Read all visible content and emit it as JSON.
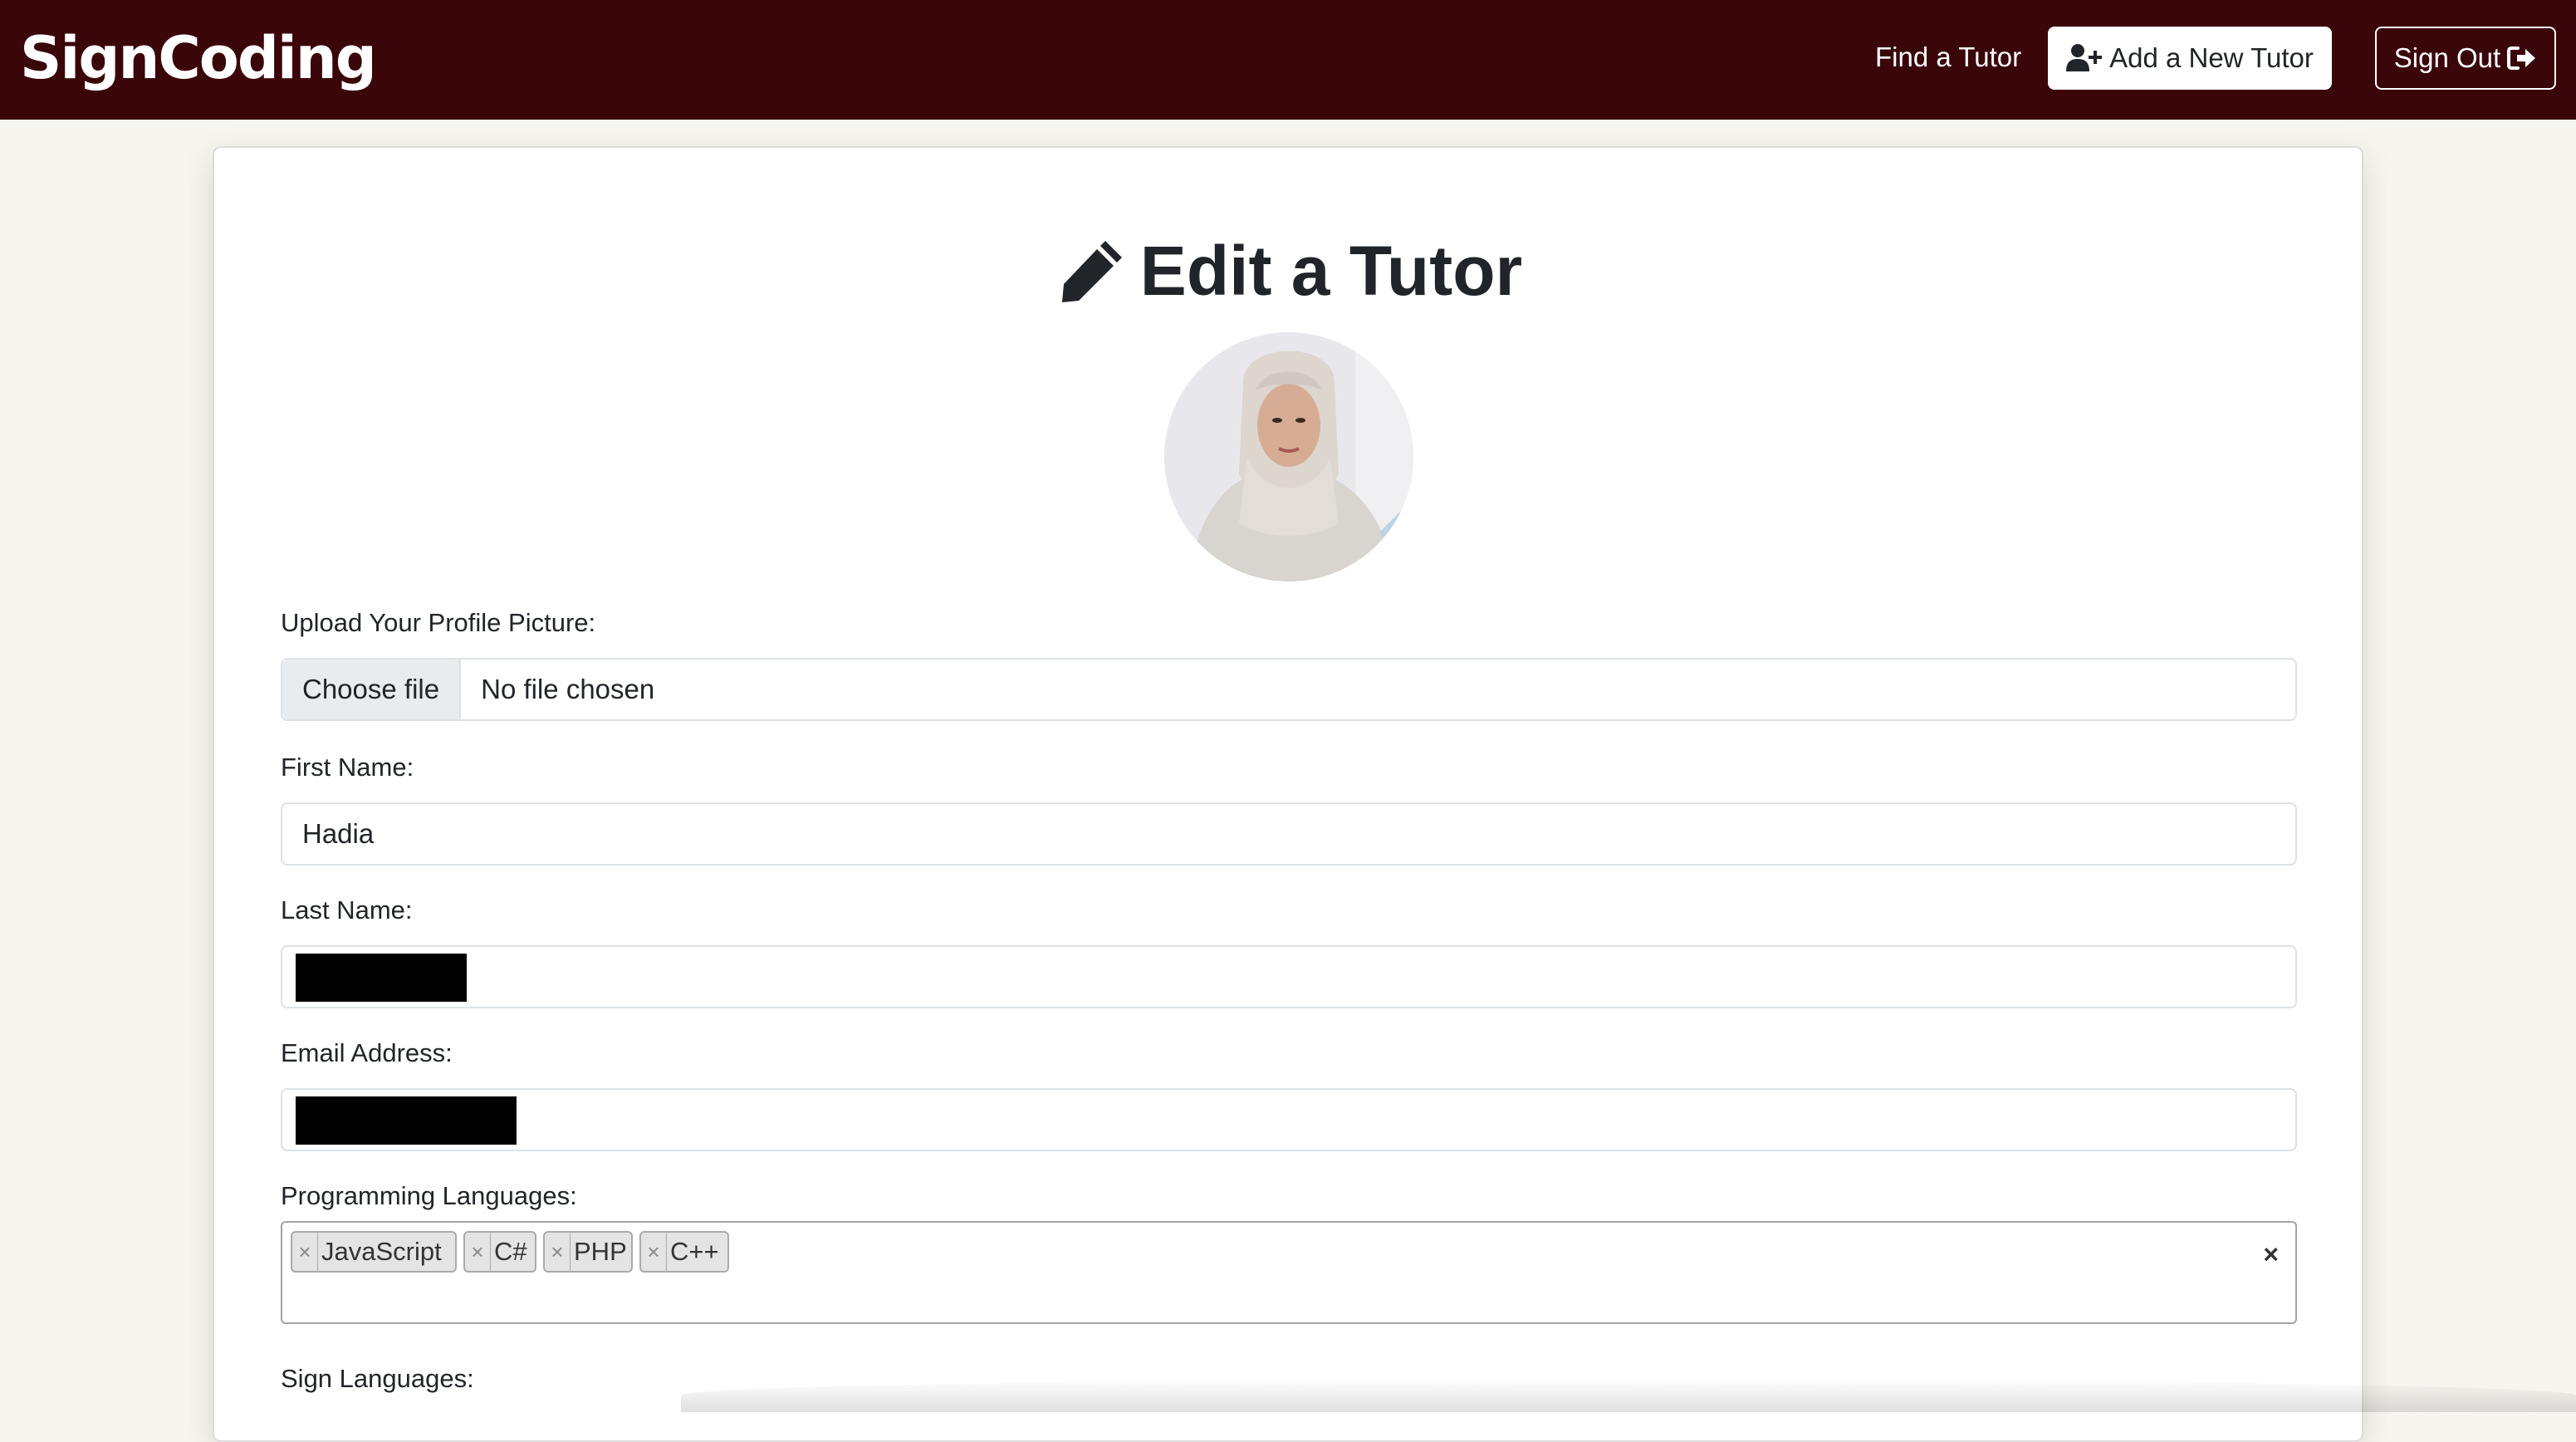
{
  "header": {
    "brand": "SignCoding",
    "nav_find": "Find a Tutor",
    "add_tutor_label": "Add a New Tutor",
    "sign_out_label": "Sign Out"
  },
  "form": {
    "title": "Edit a Tutor",
    "profile_picture": {
      "label": "Upload Your Profile Picture:",
      "button": "Choose file",
      "status": "No file chosen"
    },
    "first_name": {
      "label": "First Name:",
      "value": "Hadia"
    },
    "last_name": {
      "label": "Last Name:"
    },
    "email": {
      "label": "Email Address:"
    },
    "programming_languages": {
      "label": "Programming Languages:",
      "tags": [
        "JavaScript",
        "C#",
        "PHP",
        "C++"
      ],
      "remove_symbol": "×",
      "clear_symbol": "×"
    },
    "sign_languages": {
      "label": "Sign Languages:"
    }
  },
  "colors": {
    "navbar": "#3a060a",
    "page_background": "#f7f5f0"
  },
  "icons": [
    "pencil-icon",
    "user-plus-icon",
    "sign-out-icon"
  ]
}
